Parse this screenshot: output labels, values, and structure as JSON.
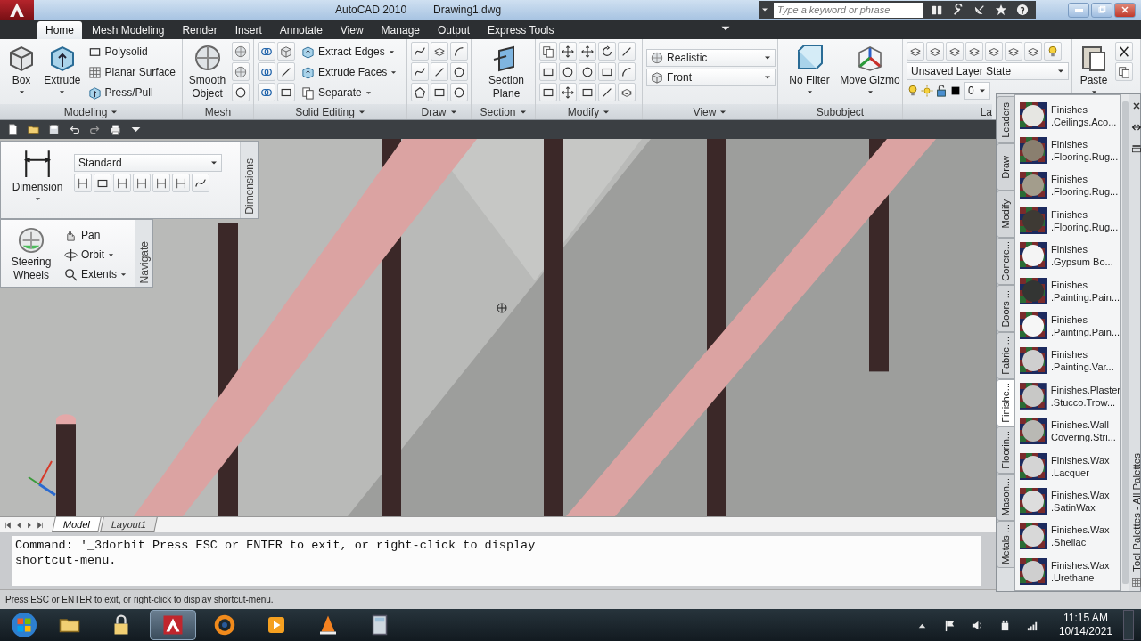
{
  "window": {
    "title": "AutoCAD 2010",
    "document": "Drawing1.dwg"
  },
  "search": {
    "placeholder": "Type a keyword or phrase"
  },
  "ribbon_tabs": [
    {
      "label": "Home",
      "selected": true
    },
    {
      "label": "Mesh Modeling",
      "selected": false
    },
    {
      "label": "Render",
      "selected": false
    },
    {
      "label": "Insert",
      "selected": false
    },
    {
      "label": "Annotate",
      "selected": false
    },
    {
      "label": "View",
      "selected": false
    },
    {
      "label": "Manage",
      "selected": false
    },
    {
      "label": "Output",
      "selected": false
    },
    {
      "label": "Express Tools",
      "selected": false
    }
  ],
  "ribbon_panels": [
    {
      "kind": "modeling",
      "title": "Modeling",
      "labels": [
        "Box",
        "Extrude",
        "Polysolid",
        "Planar Surface",
        "Press/Pull"
      ]
    },
    {
      "kind": "mesh",
      "title": "Mesh",
      "labels": [
        "Smooth\nObject"
      ]
    },
    {
      "kind": "solid_editing",
      "title": "Solid Editing",
      "labels": [
        "Extract Edges",
        "Extrude Faces",
        "Separate"
      ]
    },
    {
      "kind": "draw",
      "title": "Draw"
    },
    {
      "kind": "section",
      "title": "Section",
      "labels": [
        "Section\nPlane"
      ]
    },
    {
      "kind": "modify",
      "title": "Modify"
    },
    {
      "kind": "view",
      "title": "View",
      "labels": [
        "Realistic",
        "Front"
      ]
    },
    {
      "kind": "subobject",
      "title": "Subobject",
      "labels": [
        "No Filter",
        "Move Gizmo"
      ]
    },
    {
      "kind": "layers",
      "title": "La",
      "labels": [
        "Unsaved Layer State",
        "0"
      ]
    },
    {
      "kind": "clipboard",
      "labels": [
        "Paste"
      ]
    }
  ],
  "dimensions_panel": {
    "title": "Dimensions",
    "button": "Dimension",
    "style": "Standard"
  },
  "navigate_panel": {
    "title": "Navigate",
    "wheel": "Steering\nWheels",
    "tools": [
      "Pan",
      "Orbit",
      "Extents"
    ]
  },
  "layout_tabs": [
    {
      "label": "Model",
      "selected": true
    },
    {
      "label": "Layout1",
      "selected": false
    }
  ],
  "command_line": {
    "lines": [
      "Command: '_3dorbit Press ESC or ENTER to exit, or right-click to display",
      "shortcut-menu."
    ]
  },
  "status_bar": {
    "text": "Press ESC or ENTER to exit, or right-click to display shortcut-menu."
  },
  "tool_palette": {
    "title": "Tool Palettes - All Palettes",
    "tabs": [
      {
        "label": "Leaders",
        "selected": false
      },
      {
        "label": "Draw",
        "selected": false
      },
      {
        "label": "Modify",
        "selected": false
      },
      {
        "label": "Concre...",
        "selected": false
      },
      {
        "label": "Doors ...",
        "selected": false
      },
      {
        "label": "Fabric ...",
        "selected": false
      },
      {
        "label": "Finishe...",
        "selected": true
      },
      {
        "label": "Floorin...",
        "selected": false
      },
      {
        "label": "Mason...",
        "selected": false
      },
      {
        "label": "Metals ...",
        "selected": false
      }
    ],
    "items": [
      {
        "lines": [
          "Finishes",
          ".Ceilings.Aco..."
        ],
        "color": "#e6e6e2"
      },
      {
        "lines": [
          "Finishes",
          ".Flooring.Rug..."
        ],
        "color": "#8a7f6f"
      },
      {
        "lines": [
          "Finishes",
          ".Flooring.Rug..."
        ],
        "color": "#a39d8c"
      },
      {
        "lines": [
          "Finishes",
          ".Flooring.Rug..."
        ],
        "color": "#3e3a34"
      },
      {
        "lines": [
          "Finishes",
          ".Gypsum Bo..."
        ],
        "color": "#f4f4f4"
      },
      {
        "lines": [
          "Finishes",
          ".Painting.Pain..."
        ],
        "color": "#333533"
      },
      {
        "lines": [
          "Finishes",
          ".Painting.Pain..."
        ],
        "color": "#f6f6f6"
      },
      {
        "lines": [
          "Finishes",
          ".Painting.Var..."
        ],
        "color": "#cfcfcf"
      },
      {
        "lines": [
          "Finishes.Plaster",
          ".Stucco.Trow..."
        ],
        "color": "#c8c8c6"
      },
      {
        "lines": [
          "Finishes.Wall",
          "Covering.Stri..."
        ],
        "color": "#b9b9b4"
      },
      {
        "lines": [
          "Finishes.Wax",
          ".Lacquer"
        ],
        "color": "#d4d4d4"
      },
      {
        "lines": [
          "Finishes.Wax",
          ".SatinWax"
        ],
        "color": "#dddddd"
      },
      {
        "lines": [
          "Finishes.Wax",
          ".Shellac"
        ],
        "color": "#d8d8d8"
      },
      {
        "lines": [
          "Finishes.Wax",
          ".Urethane"
        ],
        "color": "#cfcfcf"
      }
    ]
  },
  "taskbar": {
    "buttons": [
      {
        "kind": "start",
        "selected": false
      },
      {
        "kind": "folder",
        "selected": false
      },
      {
        "kind": "lock",
        "selected": false
      },
      {
        "kind": "cad",
        "selected": true
      },
      {
        "kind": "ring",
        "selected": false
      },
      {
        "kind": "media",
        "selected": false
      },
      {
        "kind": "cone",
        "selected": false
      },
      {
        "kind": "calculator",
        "selected": false
      }
    ],
    "time": "11:15 AM",
    "date": "10/14/2021"
  }
}
